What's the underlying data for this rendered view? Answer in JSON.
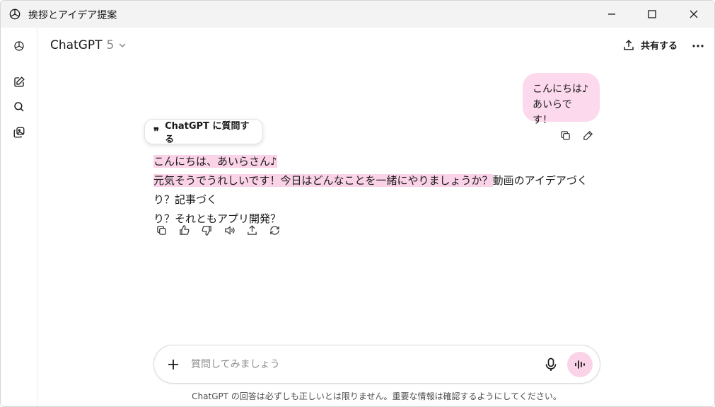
{
  "window": {
    "title": "挨拶とアイデア提案"
  },
  "header": {
    "model_name": "ChatGPT",
    "model_version": "5",
    "share_label": "共有する"
  },
  "conversation": {
    "user_message_line1": "こんにちは♪",
    "user_message_line2": "あいらです！",
    "ask_popup_label": "ChatGPT に質問する",
    "assistant_line1": "こんにちは、あいらさん♪",
    "assistant_line2_highlighted": "元気そうでうれしいです！今日はどんなことを一緒にやりましょうか？",
    "assistant_line2_rest": "動画のアイデアづくり？記事づく",
    "assistant_line3": "り？それともアプリ開発？"
  },
  "composer": {
    "placeholder": "質問してみましょう"
  },
  "footer": {
    "disclaimer": "ChatGPT の回答は必ずしも正しいとは限りません。重要な情報は確認するようにしてください。"
  },
  "colors": {
    "highlight": "#fbd3e8",
    "user_bubble": "#fcd9ec",
    "titlebar": "#f3f3f3"
  },
  "icons": {
    "app": "openai-logo-icon",
    "rail": [
      "openai-logo-icon",
      "new-chat-icon",
      "search-icon",
      "library-icon"
    ],
    "user_actions": [
      "copy-icon",
      "edit-icon"
    ],
    "response_actions": [
      "copy-icon",
      "thumbs-up-icon",
      "thumbs-down-icon",
      "read-aloud-icon",
      "share-icon",
      "regenerate-icon"
    ]
  }
}
